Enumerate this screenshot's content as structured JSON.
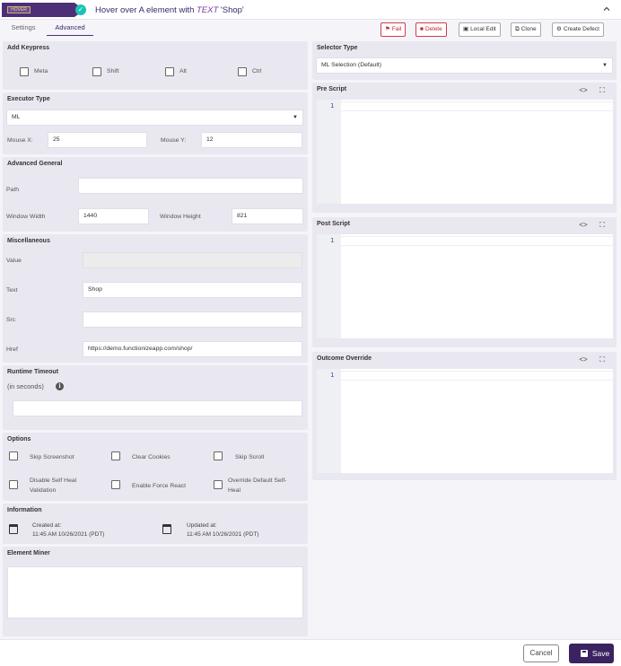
{
  "header": {
    "action_badge": "HOVER",
    "check_glyph": "✓",
    "title_prefix": "Hover over A  element with ",
    "title_keyword": "TEXT",
    "title_suffix": " 'Shop'",
    "collapse_icon": "chevron-up-icon"
  },
  "tabs": [
    {
      "label": "Settings",
      "active": false
    },
    {
      "label": "Advanced",
      "active": true
    }
  ],
  "toolbar": {
    "fail_label": "Fail",
    "delete_label": "Delete",
    "local_edit_label": "Local Edit",
    "clone_label": "Clone",
    "create_defect_label": "Create Defect"
  },
  "add_keypress": {
    "title": "Add Keypress",
    "options": [
      "Meta",
      "Shift",
      "Alt",
      "Ctrl"
    ]
  },
  "executor_type": {
    "title": "Executor Type",
    "selected": "ML",
    "mouse_x_label": "Mouse X:",
    "mouse_x_value": "25",
    "mouse_y_label": "Mouse Y:",
    "mouse_y_value": "12"
  },
  "advanced_general": {
    "title": "Advanced General",
    "path_label": "Path",
    "path_value": "",
    "window_width_label": "Window Width",
    "window_width_value": "1440",
    "window_height_label": "Window Height",
    "window_height_value": "821"
  },
  "miscellaneous": {
    "title": "Miscellaneous",
    "value_label": "Value",
    "value_value": "",
    "text_label": "Text",
    "text_value": "Shop",
    "src_label": "Src",
    "src_value": "",
    "href_label": "Href",
    "href_value": "https://demo.functionizeapp.com/shop/"
  },
  "runtime_timeout": {
    "title": "Runtime Timeout",
    "subtitle": "(in seconds)",
    "info_glyph": "i",
    "value": ""
  },
  "options": {
    "title": "Options",
    "skip_screenshot": "Skip Screenshot",
    "clear_cookies": "Clear Cookies",
    "skip_scroll": "Skip Scroll",
    "disable_self_heal_1": "Disable Self Heal",
    "disable_self_heal_2": "Validation",
    "enable_force_react": "Enable Force React",
    "override_self_heal_1": "Override Default Self-",
    "override_self_heal_2": "Heal"
  },
  "information": {
    "title": "Information",
    "created_label": "Created at:",
    "created_value": "11:45 AM 10/26/2021 (PDT)",
    "updated_label": "Updated at:",
    "updated_value": "11:45 AM 10/26/2021 (PDT)"
  },
  "element_miner": {
    "title": "Element Miner",
    "value": ""
  },
  "selector_type": {
    "title": "Selector Type",
    "selected": "ML Selection (Default)"
  },
  "pre_script": {
    "title": "Pre Script",
    "line_number": "1"
  },
  "post_script": {
    "title": "Post Script",
    "line_number": "1"
  },
  "outcome_override": {
    "title": "Outcome Override",
    "line_number": "1"
  },
  "editor_tools": {
    "code_glyph": "<>",
    "expand_glyph": "⛶"
  },
  "footer": {
    "cancel_label": "Cancel",
    "save_label": "Save"
  },
  "colors": {
    "brand": "#4d2f78",
    "save_button": "#3a2360",
    "danger": "#d23b4b",
    "success": "#19c4b5",
    "panel": "#e9e7f0"
  }
}
